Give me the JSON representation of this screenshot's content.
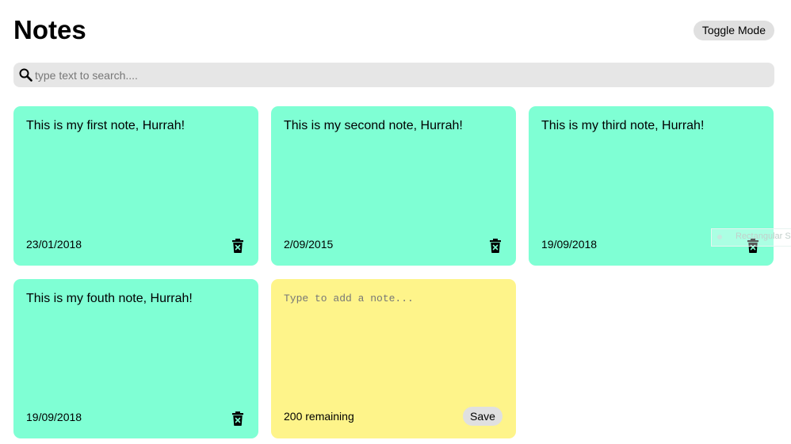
{
  "header": {
    "title": "Notes",
    "toggle_label": "Toggle Mode"
  },
  "search": {
    "placeholder": "type text to search....",
    "value": ""
  },
  "notes": [
    {
      "text": "This is my first note, Hurrah!",
      "date": "23/01/2018"
    },
    {
      "text": "This is my second note, Hurrah!",
      "date": "2/09/2015"
    },
    {
      "text": "This is my third note, Hurrah!",
      "date": "19/09/2018"
    },
    {
      "text": "This is my fouth note, Hurrah!",
      "date": "19/09/2018"
    }
  ],
  "new_note": {
    "placeholder": "Type to add a note...",
    "remaining": "200 remaining",
    "save_label": "Save"
  },
  "tooltip": {
    "label": "Rectangular S"
  },
  "colors": {
    "note": "#7fffd4",
    "new_note": "#fef48a",
    "button": "#e0e0e0",
    "search": "#e6e6e6"
  },
  "icons": {
    "search": "search-icon",
    "delete": "trash-icon"
  }
}
